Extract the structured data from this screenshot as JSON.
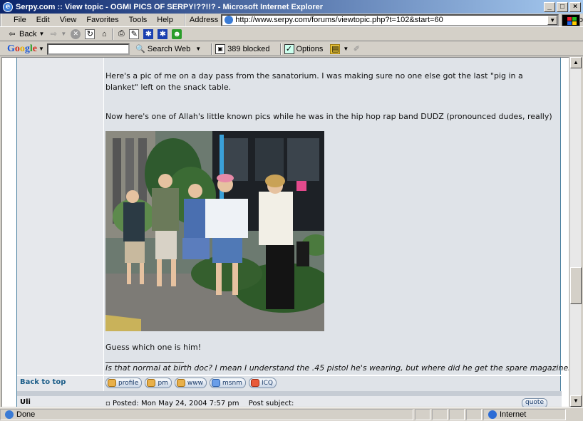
{
  "window": {
    "title": "Serpy.com :: View topic - OGMI PICS OF SERPY!??!!? - Microsoft Internet Explorer",
    "controls": [
      "_",
      "□",
      "×"
    ]
  },
  "menu": {
    "items": [
      "File",
      "Edit",
      "View",
      "Favorites",
      "Tools",
      "Help"
    ],
    "address_label": "Address",
    "url": "http://www.serpy.com/forums/viewtopic.php?t=102&start=60",
    "go_label": "Go"
  },
  "toolbar": {
    "back_label": "Back"
  },
  "googlebar": {
    "logo": "Google",
    "search_web_label": "Search Web",
    "blocked_label": "389 blocked",
    "options_label": "Options"
  },
  "post": {
    "para1": "Here's a pic of me on a day pass from the sanatorium. I was making sure no one else got the last \"pig in a blanket\" left on the snack table.",
    "para2": "Now here's one of Allah's little known pics while he was in the hip hop rap band DUDZ (pronounced dudes, really)",
    "para3": "Guess which one is him!",
    "signature": "Is that normal at birth doc? I mean I understand the .45 pistol he's wearing, but where did he get the spare magazines?",
    "back_to_top": "Back to top",
    "buttons": [
      "profile",
      "pm",
      "www",
      "msnm",
      "ICQ"
    ]
  },
  "next_post": {
    "author": "Uli",
    "posted": "Posted: Mon May 24, 2004 7:57 pm",
    "subject": "Post subject:",
    "quote_label": "quote"
  },
  "status": {
    "left": "Done",
    "zone": "Internet"
  }
}
